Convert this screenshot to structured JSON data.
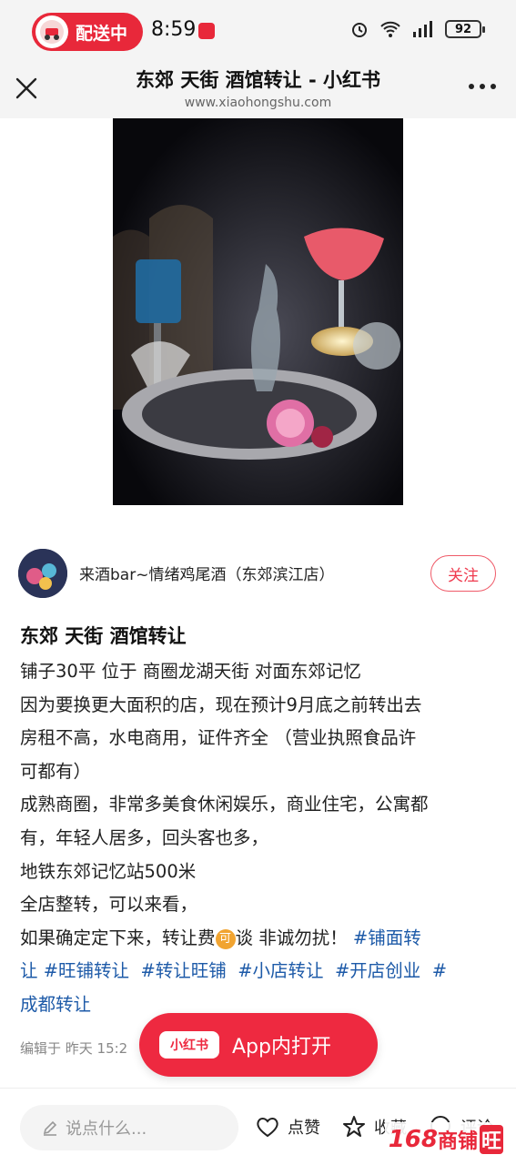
{
  "status_bar": {
    "delivery_label": "配送中",
    "time": "8:59",
    "battery": "92"
  },
  "header": {
    "title": "东郊 天街 酒馆转让 - 小红书",
    "url": "www.xiaohongshu.com"
  },
  "author": {
    "name": "来酒bar~情绪鸡尾酒（东郊滨江店）",
    "follow_label": "关注"
  },
  "note": {
    "title": "东郊 天街 酒馆转让",
    "lines": [
      "铺子30平 位于 商圈龙湖天街 对面东郊记忆",
      "因为要换更大面积的店，现在预计9月底之前转出去",
      "房租不高，水电商用，证件齐全 （营业执照食品许",
      "可都有）",
      "成熟商圈，非常多美食休闲娱乐，商业住宅，公寓都",
      "有，年轻人居多，回头客也多，",
      "地铁东郊记忆站500米",
      "全店整转，可以来看，"
    ],
    "line9_prefix": "如果确定定下来，转让费",
    "line9_badge": "可",
    "line9_suffix": "谈 非诚勿扰！",
    "tag_1a": "#铺面转",
    "tag_1b": "让",
    "tag_2": "#旺铺转让",
    "tag_3": "#转让旺铺",
    "tag_4": "#小店转让",
    "tag_5": "#开店创业",
    "tag_6a": "#",
    "tag_6b": "成都转让",
    "edited": "编辑于  昨天 15:2"
  },
  "open_app": {
    "logo": "小红书",
    "label": "App内打开"
  },
  "bottom_bar": {
    "comment_placeholder": "说点什么...",
    "like_label": "点赞",
    "fav_label": "收藏",
    "comment_label": "评论"
  },
  "watermark": {
    "num": "168",
    "text": "商铺",
    "last": "旺"
  },
  "colors": {
    "brand_red": "#ee2940",
    "hashtag_blue": "#1d5aa8",
    "status_bar_bg": "#f4f4f4"
  }
}
